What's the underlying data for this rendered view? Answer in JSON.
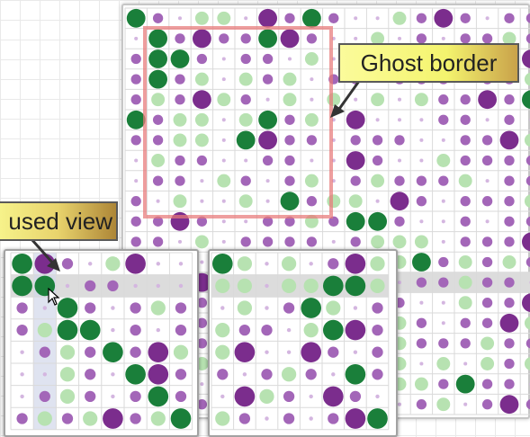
{
  "labels": {
    "ghost_border": "Ghost border",
    "focused_view": "used view"
  },
  "colors": {
    "green_strong": "#1a7f3a",
    "green_mid": "#5eaf6e",
    "green_light": "#b7e2b1",
    "purple_strong": "#7b2d8d",
    "purple_mid": "#a366b8",
    "purple_light": "#d4b6e0",
    "ghost_border": "#e87878"
  },
  "views": {
    "main": {
      "name": "matrix-overview",
      "rows": 20,
      "cols": 19,
      "highlighted_row": 13,
      "values": [
        "Gp.gg.PpGp..gpPp.ppp",
        ".GpPppGPp..g.p.ppgpp",
        "pGGp.pp.g...pp..ppPg",
        "pGpg.gpg.pp.ppp.ppgp",
        "pgpPgp.g.g.g.gppPpGp",
        "Gpgg.gGpg.P...pp.p.p",
        "ppgg.GPpp.ppp..ppPgp",
        ".gpp..pp..Pp..gpppp.",
        ".pp.gp.pg.pgpppg.ppg",
        "p.g..g.Gpgg.Pp.pppg.",
        "ppPp..ppgpGGp..p.ppg",
        "pp.g.pppp.pggg.pppPp",
        "pp..p.gGpp.ggGpgpgpp",
        "GG.Pg.pgpPp..ppgpp.p",
        "p.ppg.pggp.Pp..gppPp",
        ".g.pPppp.gp.gp.ppPgP",
        ".pgpG..pPPp.gpppgpp.",
        ".gpgPP.gp.gpg.g.gpgp",
        "gpp.pg..pp..ggpGpp.p",
        ".g.pp.p.pPgp.pg.pPpg"
      ]
    },
    "focus": {
      "name": "focused-view",
      "rows": 8,
      "cols": 8,
      "highlighted_row": 1,
      "highlighted_col": 1,
      "values": [
        "GPp.gP..",
        "GG.pp...",
        "p.Gp.pgp",
        "pgGG.p.p",
        ".pgpGpPg",
        "..gp.GPp",
        ".pgp.pGp",
        "pgpgPpgG"
      ]
    },
    "context": {
      "name": "context-view",
      "rows": 8,
      "cols": 8,
      "highlighted_row": 1,
      "values": [
        "Gg.g.pPg",
        "gg.ggGGg",
        ".g.pGg.p",
        "gpp.gGPp",
        "gP..Pp.p",
        "p.pgp.Gp",
        ".Pgp.Pp.",
        "gp.p.pPG"
      ]
    }
  }
}
